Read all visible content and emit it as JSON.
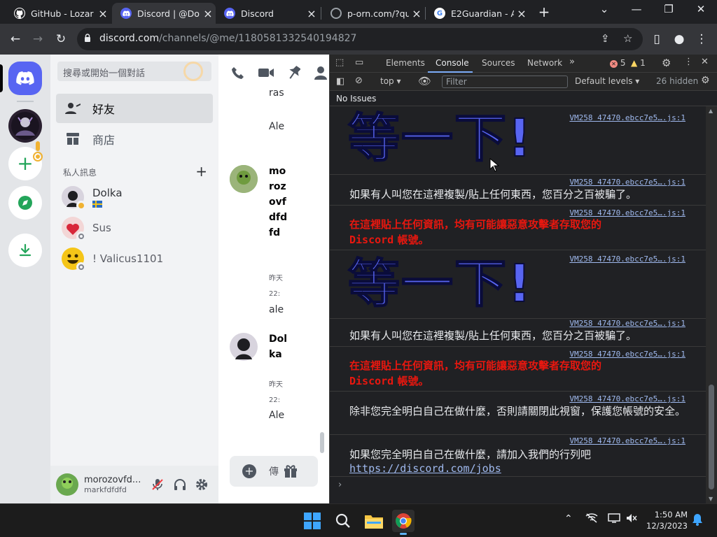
{
  "browser": {
    "tabs": [
      {
        "title": "GitHub - Lozar",
        "icon": "github-icon",
        "active": false
      },
      {
        "title": "Discord | @Dol",
        "icon": "discord-icon",
        "active": true
      },
      {
        "title": "Discord",
        "icon": "discord-icon",
        "active": false
      },
      {
        "title": "p-orn.com/?qu",
        "icon": "globe-icon",
        "active": false
      },
      {
        "title": "E2Guardian - A",
        "icon": "google-icon",
        "active": false
      }
    ],
    "url_domain": "discord.com",
    "url_path": "/channels/@me/1180581332540194827"
  },
  "discord": {
    "search_placeholder": "搜尋或開始一個對話",
    "nav": {
      "friends": "好友",
      "shop": "商店"
    },
    "dm_header": "私人訊息",
    "dm_add": "+",
    "dms": [
      {
        "name": "Dolka",
        "extra": "sweden-flag"
      },
      {
        "name": "Sus",
        "extra": ""
      },
      {
        "name": "! Valicus1101",
        "extra": ""
      }
    ],
    "user": {
      "name": "morozovfd...",
      "tag": "markfdfdfd"
    },
    "chat_fragments": {
      "top": [
        "ras",
        "Ale"
      ],
      "msg1_name": "morozovfdfdfd",
      "msg1_time1": "昨天",
      "msg1_time2": "22:",
      "msg1_text": "ale",
      "msg2_name": "Dolka",
      "msg2_time1": "昨天",
      "msg2_time2": "22:",
      "msg2_text": "Ale"
    },
    "chat_input_placeholder": "傳"
  },
  "devtools": {
    "tabs": [
      "Elements",
      "Console",
      "Sources",
      "Network"
    ],
    "active_tab": "Console",
    "errors": "5",
    "warnings": "1",
    "context": "top",
    "filter_placeholder": "Filter",
    "levels": "Default levels",
    "hidden": "26 hidden",
    "issues": "No Issues",
    "source_link": "VM258 47470.ebcc7e5….js:1",
    "big_warning": "等一下!",
    "warn_line1": "如果有人叫您在這裡複製/貼上任何東西，您百分之百被騙了。",
    "red_line_a": "在這裡貼上任何資訊，均有可能讓惡意攻擊者存取您的",
    "red_line_b_mono": "Discord",
    "red_line_b_rest": " 帳號。",
    "close_line": "除非您完全明白自己在做什麼，否則請關閉此視窗，保護您帳號的安全。",
    "jobs_line": "如果您完全明白自己在做什麼，請加入我們的行列吧 ",
    "jobs_link": "https://discord.com/jobs",
    "prompt": "›"
  },
  "taskbar": {
    "time": "1:50 AM",
    "date": "12/3/2023"
  },
  "colors": {
    "blurple": "#5865f2",
    "devtools_red": "#e8170f",
    "link": "#9fb9ee"
  }
}
